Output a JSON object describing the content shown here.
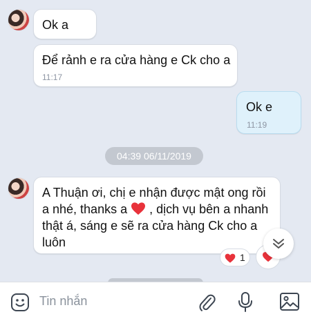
{
  "messages": [
    {
      "text": "Ok a",
      "time": ""
    },
    {
      "text": "Để rảnh e ra cửa hàng e Ck cho a",
      "time": "11:17"
    },
    {
      "text": "Ok e",
      "time": "11:19"
    }
  ],
  "date_separator": "04:39 06/11/2019",
  "last_message": {
    "line1": "A Thuận ơi, chị e nhận được mật ong rồi",
    "line2_a": "a nhé, thanks a",
    "line2_b": ", dịch vụ bên a nhanh",
    "line3": "thật á, sáng e sẽ ra cửa hàng Ck cho a",
    "line4": "luôn"
  },
  "reaction": {
    "emoji": "heart",
    "count": "1"
  },
  "composer": {
    "placeholder": "Tin nhắn"
  },
  "icons": [
    "emoji-icon",
    "attach-icon",
    "microphone-icon",
    "image-icon",
    "scroll-down-icon",
    "heart-icon"
  ],
  "colors": {
    "background": "#e4e9f2",
    "sent_bubble": "#dff1fb",
    "received_bubble": "#ffffff",
    "heart": "#e8323b"
  }
}
